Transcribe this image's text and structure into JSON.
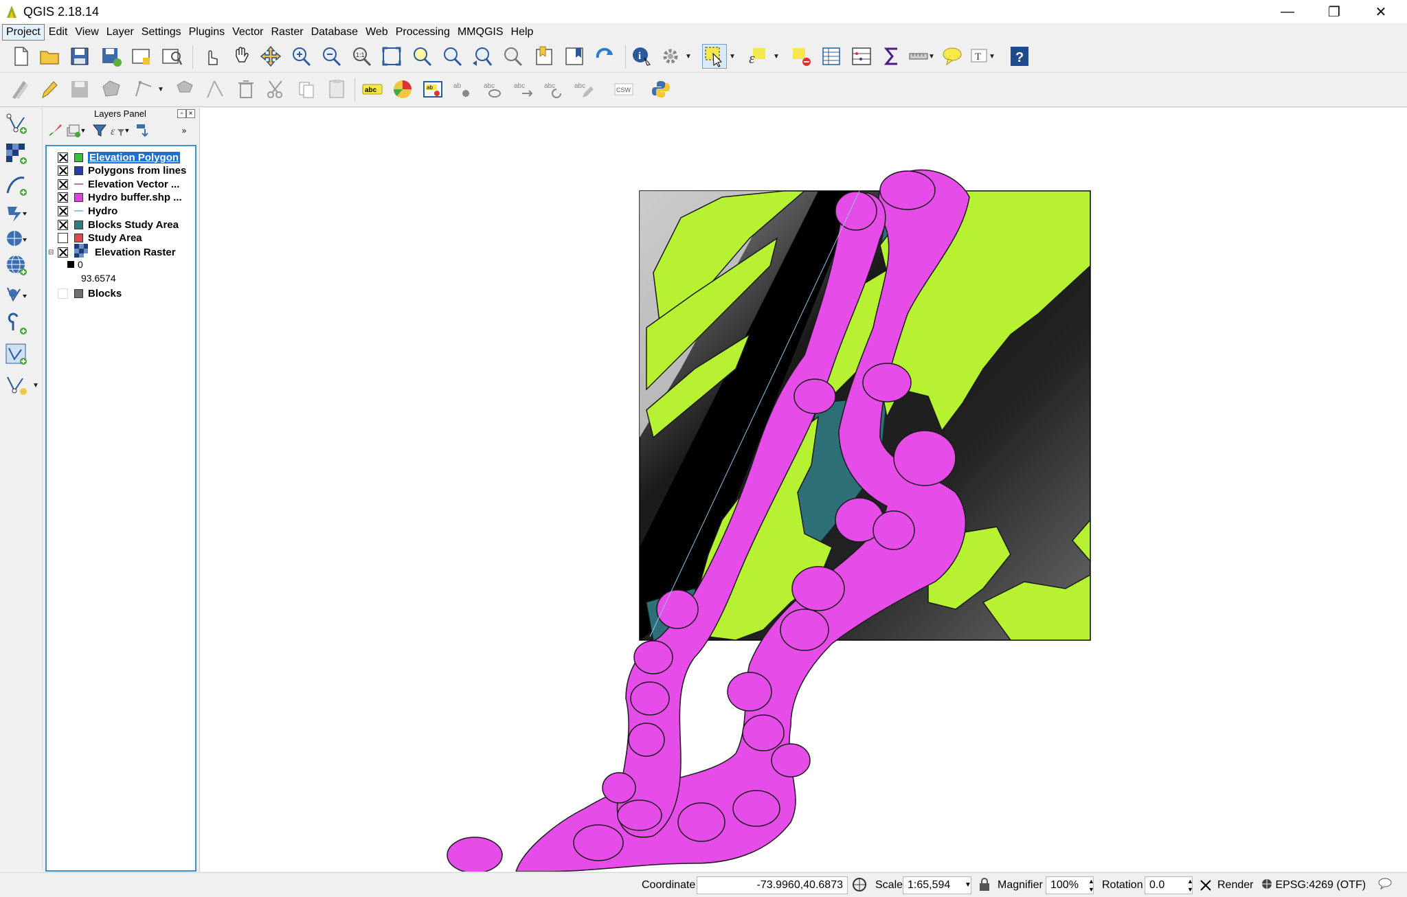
{
  "window": {
    "title": "QGIS 2.18.14",
    "controls": [
      "—",
      "❐",
      "✕"
    ]
  },
  "menu": [
    "Project",
    "Edit",
    "View",
    "Layer",
    "Settings",
    "Plugins",
    "Vector",
    "Raster",
    "Database",
    "Web",
    "Processing",
    "MMQGIS",
    "Help"
  ],
  "layers_panel": {
    "title": "Layers Panel",
    "float_btn": "▫",
    "close_btn": "×",
    "more": "»",
    "layers": [
      {
        "name": "Elevation Polygon",
        "checked": true,
        "swatch": "#3fbf3f",
        "selected": true
      },
      {
        "name": "Polygons from lines",
        "checked": true,
        "swatch": "#2a3ea8"
      },
      {
        "name": "Elevation Vector ...",
        "checked": true,
        "swatch": "line-pink"
      },
      {
        "name": "Hydro buffer.shp ...",
        "checked": true,
        "swatch": "#e23ee8"
      },
      {
        "name": "Hydro",
        "checked": true,
        "swatch": "line-blue"
      },
      {
        "name": "Blocks Study Area",
        "checked": true,
        "swatch": "#2e7d7d"
      },
      {
        "name": "Study Area",
        "checked": false,
        "swatch": "#e04a4a"
      },
      {
        "name": "Elevation Raster",
        "checked": true,
        "swatch": "raster"
      },
      {
        "name": "Blocks",
        "checked": false,
        "swatch": "#707070"
      }
    ],
    "raster_legend": {
      "min": "0",
      "max": "93.6574"
    }
  },
  "statusbar": {
    "coordinate_label": "Coordinate",
    "coordinate_value": "-73.9960,40.6873",
    "scale_label": "Scale",
    "scale_value": "1:65,594",
    "magnifier_label": "Magnifier",
    "magnifier_value": "100%",
    "rotation_label": "Rotation",
    "rotation_value": "0.0",
    "render_label": "Render",
    "crs": "EPSG:4269 (OTF)"
  },
  "toolbar_icons": {
    "row1": [
      "new-project",
      "open-project",
      "save-project",
      "save-as",
      "new-print-composer",
      "composer-manager",
      "touch-zoom",
      "pan",
      "pan-to-selection",
      "zoom-in",
      "zoom-out",
      "zoom-native",
      "zoom-full",
      "zoom-to-selection",
      "zoom-to-layer",
      "zoom-last",
      "zoom-next",
      "new-bookmark",
      "show-bookmarks",
      "refresh",
      "identify",
      "run-action",
      "select-features",
      "select-by-expression",
      "deselect",
      "open-attribute-table",
      "field-calculator",
      "statistical-summary",
      "measure",
      "map-tips",
      "text-annotation",
      "help"
    ],
    "row2": [
      "current-edits",
      "toggle-editing",
      "save-edits",
      "add-feature",
      "move-feature",
      "node-tool",
      "delete-selected",
      "cut-features",
      "copy-features",
      "paste-features",
      "label-tool",
      "diagram-tool",
      "highlight-pinned-labels",
      "pin-labels",
      "show-hide-labels",
      "move-label",
      "rotate-label",
      "change-label",
      "csw",
      "python-console"
    ]
  }
}
